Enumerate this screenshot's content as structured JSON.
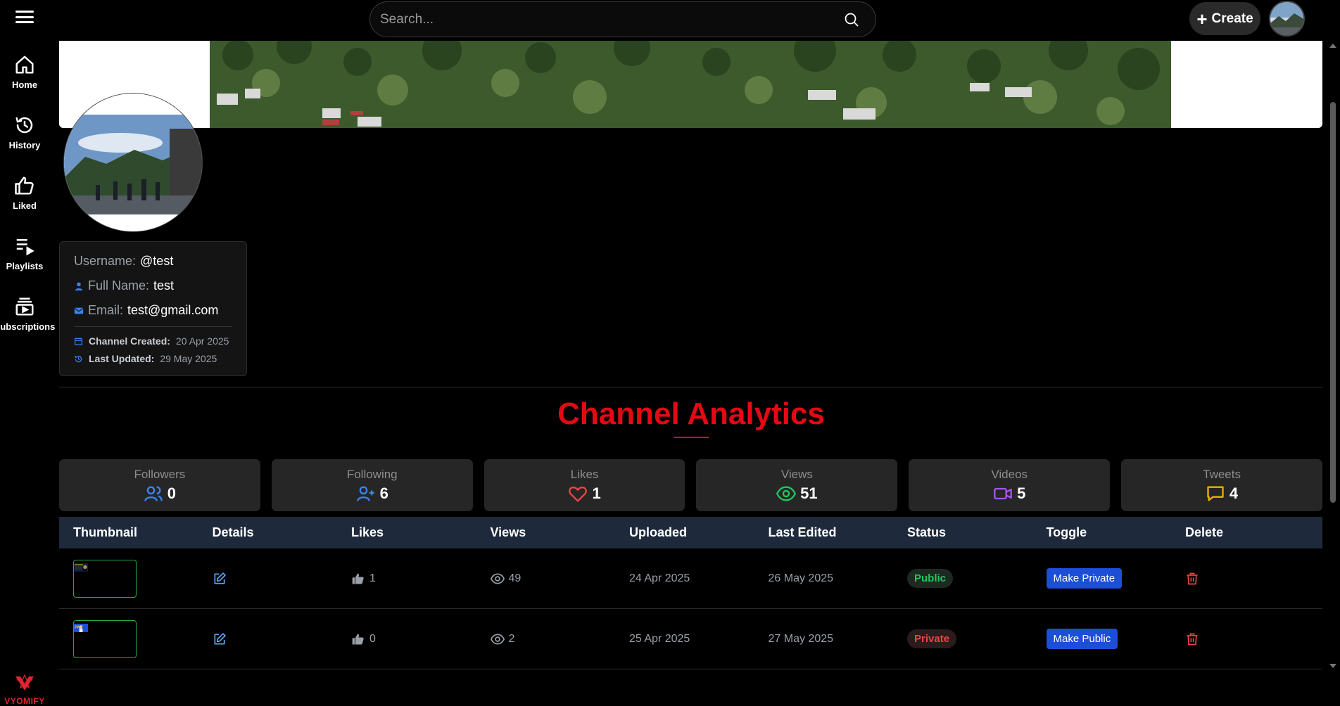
{
  "search": {
    "placeholder": "Search..."
  },
  "header": {
    "create_label": "Create"
  },
  "sidebar": {
    "items": [
      {
        "label": "Home",
        "icon": "home-icon"
      },
      {
        "label": "History",
        "icon": "history-icon"
      },
      {
        "label": "Liked",
        "icon": "thumbs-up-icon"
      },
      {
        "label": "Playlists",
        "icon": "playlist-icon"
      },
      {
        "label": "Subscriptions",
        "icon": "subscriptions-icon"
      }
    ],
    "brand": "VYOMIFY"
  },
  "profile": {
    "username_label": "Username:",
    "username": "@test",
    "fullname_label": "Full Name:",
    "fullname": "test",
    "email_label": "Email:",
    "email": "test@gmail.com",
    "created_label": "Channel Created:",
    "created": "20 Apr 2025",
    "updated_label": "Last Updated:",
    "updated": "29 May 2025"
  },
  "analytics": {
    "title": "Channel Analytics",
    "stats": [
      {
        "label": "Followers",
        "value": "0",
        "icon": "users-icon",
        "color": "#3b82f6"
      },
      {
        "label": "Following",
        "value": "6",
        "icon": "user-plus-icon",
        "color": "#3b82f6"
      },
      {
        "label": "Likes",
        "value": "1",
        "icon": "heart-icon",
        "color": "#ef4444"
      },
      {
        "label": "Views",
        "value": "51",
        "icon": "eye-icon",
        "color": "#22c55e"
      },
      {
        "label": "Videos",
        "value": "5",
        "icon": "video-icon",
        "color": "#a855f7"
      },
      {
        "label": "Tweets",
        "value": "4",
        "icon": "message-icon",
        "color": "#eab308"
      }
    ]
  },
  "table": {
    "headers": [
      "Thumbnail",
      "Details",
      "Likes",
      "Views",
      "Uploaded",
      "Last Edited",
      "Status",
      "Toggle",
      "Delete"
    ],
    "rows": [
      {
        "likes": "1",
        "views": "49",
        "uploaded": "24 Apr 2025",
        "edited": "26 May 2025",
        "status": "Public",
        "toggle": "Make Private",
        "thumb_text": "BACKEND"
      },
      {
        "likes": "0",
        "views": "2",
        "uploaded": "25 Apr 2025",
        "edited": "27 May 2025",
        "status": "Private",
        "toggle": "Make Public",
        "thumb_text": "JWT"
      }
    ]
  },
  "colors": {
    "accent": "#e50914",
    "blue": "#1d4ed8",
    "table_head": "#1e293b"
  }
}
